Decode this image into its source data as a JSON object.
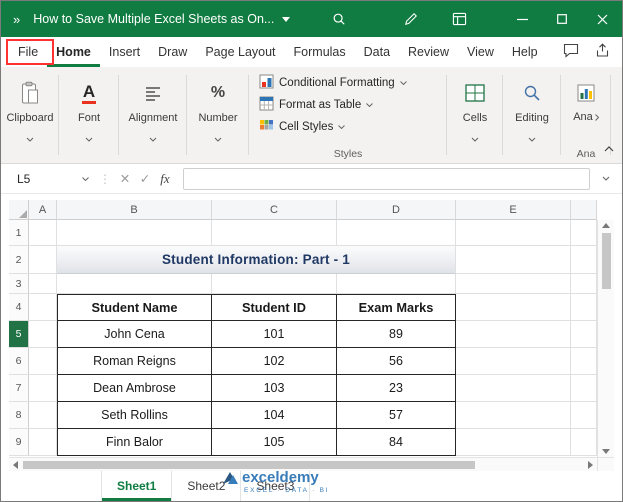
{
  "window": {
    "overflow_chevrons": "»",
    "title": "How to Save Multiple Excel Sheets as On..."
  },
  "menu": {
    "tabs": [
      "File",
      "Home",
      "Insert",
      "Draw",
      "Page Layout",
      "Formulas",
      "Data",
      "Review",
      "View",
      "Help"
    ],
    "active_tab": "Home"
  },
  "ribbon": {
    "clipboard": "Clipboard",
    "font": "Font",
    "alignment": "Alignment",
    "number": "Number",
    "conditional_formatting": "Conditional Formatting",
    "format_as_table": "Format as Table",
    "cell_styles": "Cell Styles",
    "styles_group": "Styles",
    "cells": "Cells",
    "editing": "Editing",
    "analyze_truncated": "Ana",
    "analyze_group_truncated": "Ana"
  },
  "formula_bar": {
    "name_box": "L5",
    "fx_label": "fx",
    "formula_value": ""
  },
  "grid": {
    "column_headers": [
      "A",
      "B",
      "C",
      "D",
      "E"
    ],
    "row_headers": [
      "1",
      "2",
      "3",
      "4",
      "5",
      "6",
      "7",
      "8",
      "9"
    ],
    "selected_row_header": "5",
    "banner_title": "Student Information: Part - 1",
    "table": {
      "headers": [
        "Student Name",
        "Student ID",
        "Exam Marks"
      ],
      "rows": [
        [
          "John Cena",
          "101",
          "89"
        ],
        [
          "Roman Reigns",
          "102",
          "56"
        ],
        [
          "Dean Ambrose",
          "103",
          "23"
        ],
        [
          "Seth Rollins",
          "104",
          "57"
        ],
        [
          "Finn Balor",
          "105",
          "84"
        ]
      ]
    }
  },
  "sheets": {
    "tabs": [
      "Sheet1",
      "Sheet2",
      "Sheet3"
    ],
    "active": "Sheet1"
  },
  "watermark": {
    "brand": "exceldemy",
    "tagline": "EXCEL · DATA · BI"
  },
  "colors": {
    "excel_green": "#107C41",
    "banner_navy": "#1F3864",
    "annotation_red": "#FF3131",
    "watermark_blue": "#2E75B6",
    "selected_row_green": "#217346"
  }
}
